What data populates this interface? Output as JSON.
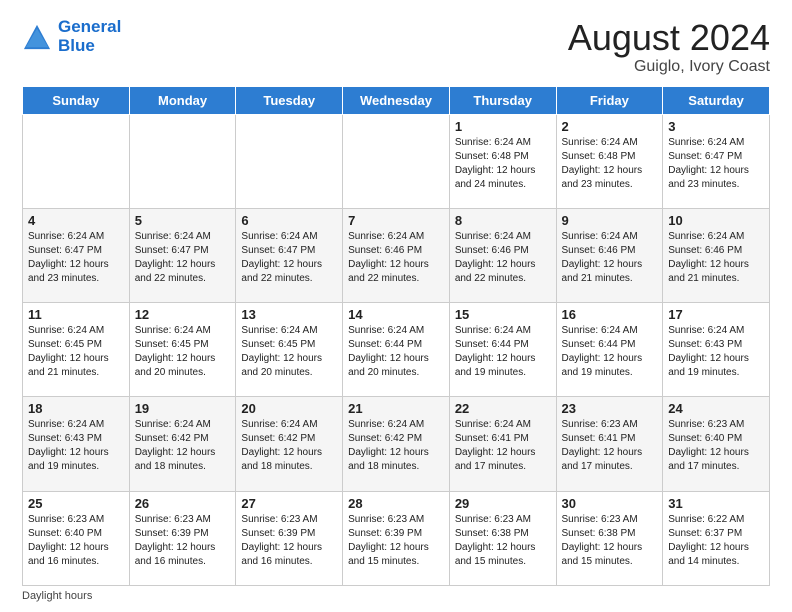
{
  "header": {
    "logo_line1": "General",
    "logo_line2": "Blue",
    "title": "August 2024",
    "subtitle": "Guiglo, Ivory Coast"
  },
  "days_of_week": [
    "Sunday",
    "Monday",
    "Tuesday",
    "Wednesday",
    "Thursday",
    "Friday",
    "Saturday"
  ],
  "footnote": "Daylight hours",
  "weeks": [
    [
      {
        "day": "",
        "info": ""
      },
      {
        "day": "",
        "info": ""
      },
      {
        "day": "",
        "info": ""
      },
      {
        "day": "",
        "info": ""
      },
      {
        "day": "1",
        "info": "Sunrise: 6:24 AM\nSunset: 6:48 PM\nDaylight: 12 hours\nand 24 minutes."
      },
      {
        "day": "2",
        "info": "Sunrise: 6:24 AM\nSunset: 6:48 PM\nDaylight: 12 hours\nand 23 minutes."
      },
      {
        "day": "3",
        "info": "Sunrise: 6:24 AM\nSunset: 6:47 PM\nDaylight: 12 hours\nand 23 minutes."
      }
    ],
    [
      {
        "day": "4",
        "info": "Sunrise: 6:24 AM\nSunset: 6:47 PM\nDaylight: 12 hours\nand 23 minutes."
      },
      {
        "day": "5",
        "info": "Sunrise: 6:24 AM\nSunset: 6:47 PM\nDaylight: 12 hours\nand 22 minutes."
      },
      {
        "day": "6",
        "info": "Sunrise: 6:24 AM\nSunset: 6:47 PM\nDaylight: 12 hours\nand 22 minutes."
      },
      {
        "day": "7",
        "info": "Sunrise: 6:24 AM\nSunset: 6:46 PM\nDaylight: 12 hours\nand 22 minutes."
      },
      {
        "day": "8",
        "info": "Sunrise: 6:24 AM\nSunset: 6:46 PM\nDaylight: 12 hours\nand 22 minutes."
      },
      {
        "day": "9",
        "info": "Sunrise: 6:24 AM\nSunset: 6:46 PM\nDaylight: 12 hours\nand 21 minutes."
      },
      {
        "day": "10",
        "info": "Sunrise: 6:24 AM\nSunset: 6:46 PM\nDaylight: 12 hours\nand 21 minutes."
      }
    ],
    [
      {
        "day": "11",
        "info": "Sunrise: 6:24 AM\nSunset: 6:45 PM\nDaylight: 12 hours\nand 21 minutes."
      },
      {
        "day": "12",
        "info": "Sunrise: 6:24 AM\nSunset: 6:45 PM\nDaylight: 12 hours\nand 20 minutes."
      },
      {
        "day": "13",
        "info": "Sunrise: 6:24 AM\nSunset: 6:45 PM\nDaylight: 12 hours\nand 20 minutes."
      },
      {
        "day": "14",
        "info": "Sunrise: 6:24 AM\nSunset: 6:44 PM\nDaylight: 12 hours\nand 20 minutes."
      },
      {
        "day": "15",
        "info": "Sunrise: 6:24 AM\nSunset: 6:44 PM\nDaylight: 12 hours\nand 19 minutes."
      },
      {
        "day": "16",
        "info": "Sunrise: 6:24 AM\nSunset: 6:44 PM\nDaylight: 12 hours\nand 19 minutes."
      },
      {
        "day": "17",
        "info": "Sunrise: 6:24 AM\nSunset: 6:43 PM\nDaylight: 12 hours\nand 19 minutes."
      }
    ],
    [
      {
        "day": "18",
        "info": "Sunrise: 6:24 AM\nSunset: 6:43 PM\nDaylight: 12 hours\nand 19 minutes."
      },
      {
        "day": "19",
        "info": "Sunrise: 6:24 AM\nSunset: 6:42 PM\nDaylight: 12 hours\nand 18 minutes."
      },
      {
        "day": "20",
        "info": "Sunrise: 6:24 AM\nSunset: 6:42 PM\nDaylight: 12 hours\nand 18 minutes."
      },
      {
        "day": "21",
        "info": "Sunrise: 6:24 AM\nSunset: 6:42 PM\nDaylight: 12 hours\nand 18 minutes."
      },
      {
        "day": "22",
        "info": "Sunrise: 6:24 AM\nSunset: 6:41 PM\nDaylight: 12 hours\nand 17 minutes."
      },
      {
        "day": "23",
        "info": "Sunrise: 6:23 AM\nSunset: 6:41 PM\nDaylight: 12 hours\nand 17 minutes."
      },
      {
        "day": "24",
        "info": "Sunrise: 6:23 AM\nSunset: 6:40 PM\nDaylight: 12 hours\nand 17 minutes."
      }
    ],
    [
      {
        "day": "25",
        "info": "Sunrise: 6:23 AM\nSunset: 6:40 PM\nDaylight: 12 hours\nand 16 minutes."
      },
      {
        "day": "26",
        "info": "Sunrise: 6:23 AM\nSunset: 6:39 PM\nDaylight: 12 hours\nand 16 minutes."
      },
      {
        "day": "27",
        "info": "Sunrise: 6:23 AM\nSunset: 6:39 PM\nDaylight: 12 hours\nand 16 minutes."
      },
      {
        "day": "28",
        "info": "Sunrise: 6:23 AM\nSunset: 6:39 PM\nDaylight: 12 hours\nand 15 minutes."
      },
      {
        "day": "29",
        "info": "Sunrise: 6:23 AM\nSunset: 6:38 PM\nDaylight: 12 hours\nand 15 minutes."
      },
      {
        "day": "30",
        "info": "Sunrise: 6:23 AM\nSunset: 6:38 PM\nDaylight: 12 hours\nand 15 minutes."
      },
      {
        "day": "31",
        "info": "Sunrise: 6:22 AM\nSunset: 6:37 PM\nDaylight: 12 hours\nand 14 minutes."
      }
    ]
  ]
}
